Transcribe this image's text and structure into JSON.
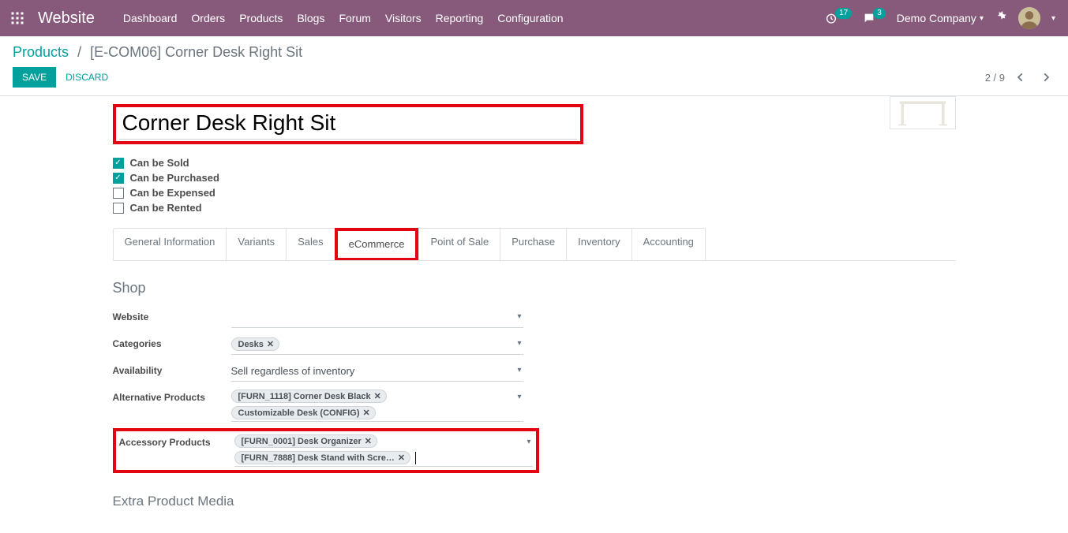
{
  "navbar": {
    "brand": "Website",
    "menu": [
      "Dashboard",
      "Orders",
      "Products",
      "Blogs",
      "Forum",
      "Visitors",
      "Reporting",
      "Configuration"
    ],
    "timer_badge": "17",
    "chat_badge": "3",
    "company": "Demo Company"
  },
  "breadcrumbs": {
    "root": "Products",
    "current": "[E-COM06] Corner Desk Right Sit"
  },
  "buttons": {
    "save": "SAVE",
    "discard": "DISCARD"
  },
  "pager": {
    "text": "2 / 9"
  },
  "product": {
    "name": "Corner Desk Right Sit",
    "checks": {
      "sold": {
        "label": "Can be Sold",
        "checked": true
      },
      "purch": {
        "label": "Can be Purchased",
        "checked": true
      },
      "exp": {
        "label": "Can be Expensed",
        "checked": false
      },
      "rent": {
        "label": "Can be Rented",
        "checked": false
      }
    }
  },
  "tabs": [
    "General Information",
    "Variants",
    "Sales",
    "eCommerce",
    "Point of Sale",
    "Purchase",
    "Inventory",
    "Accounting"
  ],
  "active_tab": "eCommerce",
  "section": {
    "title": "Shop",
    "extra_title": "Extra Product Media",
    "fields": {
      "website_lbl": "Website",
      "categories_lbl": "Categories",
      "availability_lbl": "Availability",
      "alt_lbl": "Alternative Products",
      "acc_lbl": "Accessory Products",
      "availability_val": "Sell regardless of inventory",
      "categories": [
        "Desks"
      ],
      "alt_products": [
        "[FURN_1118] Corner Desk Black",
        "Customizable Desk (CONFIG)"
      ],
      "acc_products": [
        "[FURN_0001] Desk Organizer",
        "[FURN_7888] Desk Stand with Scre…"
      ]
    }
  }
}
